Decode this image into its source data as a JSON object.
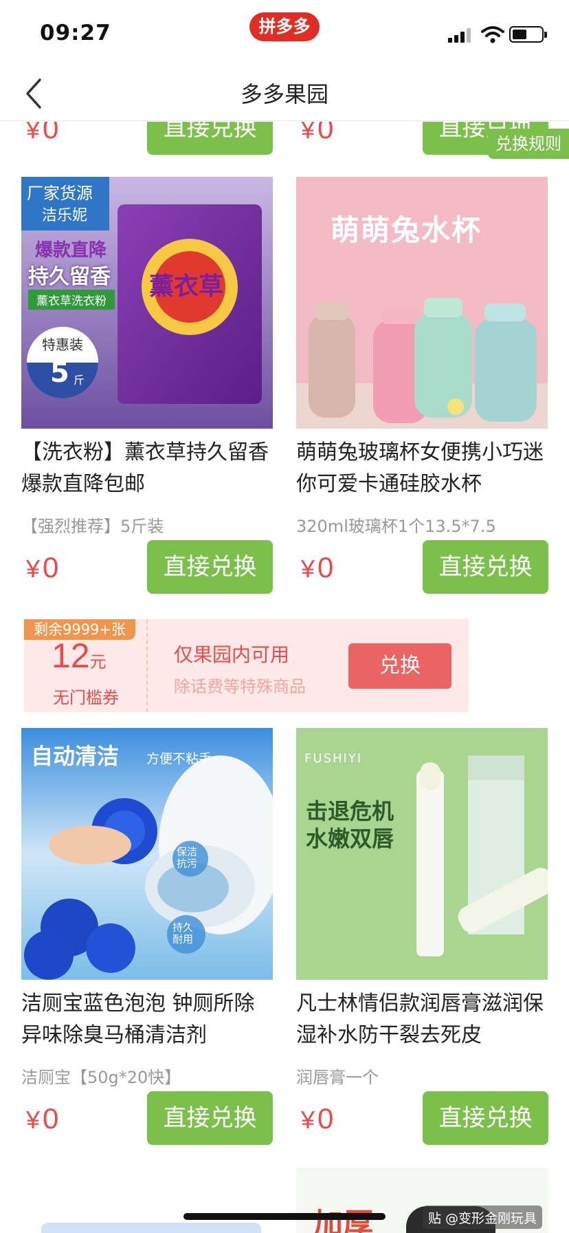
{
  "status": {
    "time": "09:27",
    "app_badge": "拼多多"
  },
  "nav": {
    "title": "多多果园",
    "back_icon": "chevron-left-icon"
  },
  "rules_label": "兑换规则",
  "top_row": {
    "left_price": "0",
    "left_button": "直接兑换",
    "right_price": "0",
    "right_button": "直接兑换"
  },
  "currency": "¥",
  "products": [
    {
      "name": "【洗衣粉】薰衣草持久留香爆款直降包邮",
      "spec": "【强烈推荐】5斤装",
      "price": "0",
      "button": "直接兑换",
      "image": {
        "tag_line1": "厂家货源",
        "tag_line2": "洁乐妮",
        "slogan1": "爆款直降",
        "slogan2": "持久留香",
        "slogan3": "薰衣草洗衣粉",
        "pack_text": "薰衣草",
        "special_label": "特惠装",
        "special_num": "5",
        "special_unit": "斤"
      }
    },
    {
      "name": "萌萌兔玻璃杯女便携小巧迷你可爱卡通硅胶水杯",
      "spec": "320ml玻璃杯1个13.5*7.5",
      "price": "0",
      "button": "直接兑换",
      "image": {
        "headline": "萌萌兔水杯"
      }
    },
    {
      "name": "洁厕宝蓝色泡泡 钟厕所除异味除臭马桶清洁剂",
      "spec": "洁厕宝【50g*20快】",
      "price": "0",
      "button": "直接兑换",
      "image": {
        "headline": "自动清洁",
        "sub": "方便不粘手",
        "bubble1": "保洁抗污",
        "bubble2": "持久耐用"
      }
    },
    {
      "name": "凡士林情侣款润唇膏滋润保湿补水防干裂去死皮",
      "spec": "润唇膏一个",
      "price": "0",
      "button": "直接兑换",
      "image": {
        "brand": "FUSHIYI",
        "headline1": "击退危机",
        "headline2": "水嫩双唇"
      }
    }
  ],
  "coupon": {
    "remaining": "剩余9999+张",
    "amount": "12",
    "unit": "元",
    "type": "无门槛券",
    "main_text": "仅果园内可用",
    "sub_text": "除话费等特殊商品",
    "button": "兑换"
  },
  "bottom_peek_text": "加厚",
  "watermark": "贴 @变形金刚玩具"
}
